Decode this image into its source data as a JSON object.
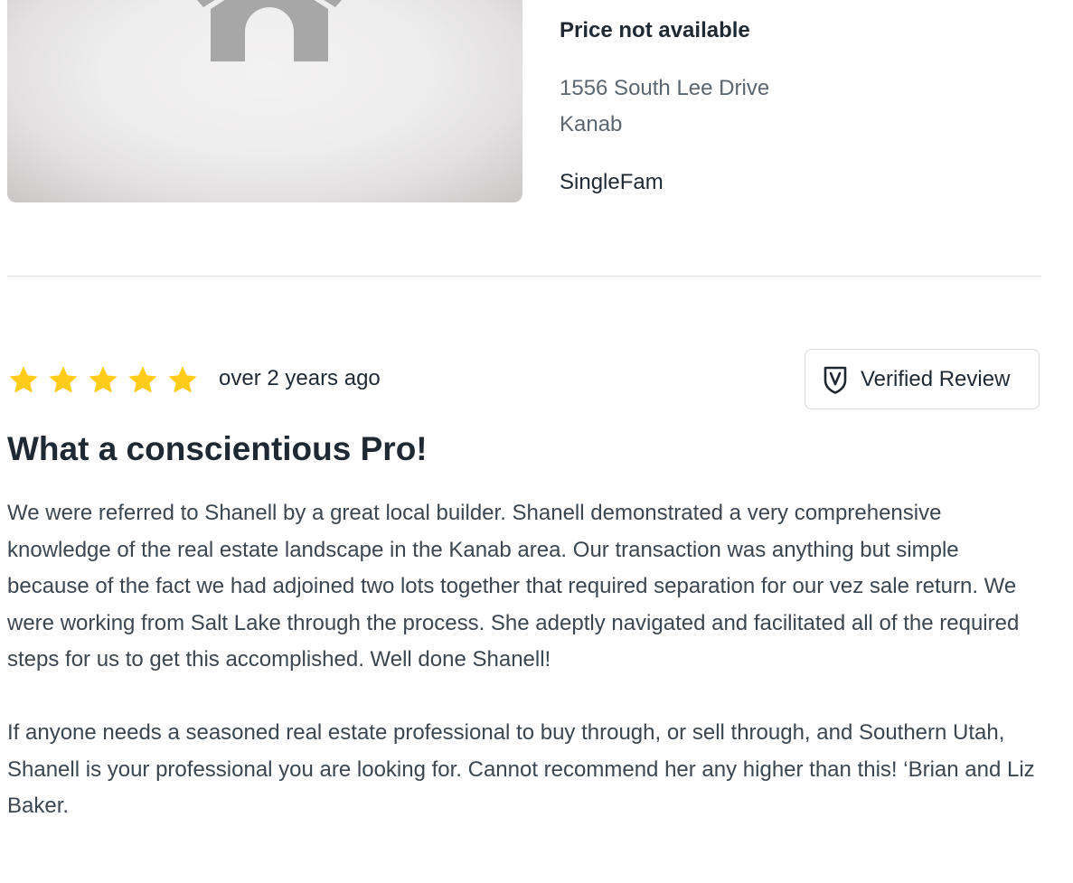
{
  "listing": {
    "price": "Price not available",
    "address_line1": "1556 South Lee Drive",
    "address_line2": "Kanab",
    "property_type": "SingleFam",
    "image_icon": "house-placeholder-icon"
  },
  "review": {
    "rating": 5,
    "rating_max": 5,
    "date": "over 2 years ago",
    "verified_label": "Verified Review",
    "verified_icon": "shield-check-icon",
    "title": "What a conscientious Pro!",
    "paragraphs": [
      "We were referred to Shanell by a great local builder.  Shanell demonstrated a very comprehensive knowledge of the real estate landscape in the Kanab area. Our transaction was anything but simple because of the fact we had adjoined two lots together that required separation for our vez sale return. We were working from Salt Lake through the process. She adeptly navigated and facilitated all of the required steps for us to get this accomplished. Well done Shanell!",
      "If anyone needs a seasoned real estate professional to buy through, or sell through, and Southern Utah, Shanell is your professional you are looking for. Cannot recommend her any higher than this! ‘Brian and Liz Baker."
    ]
  },
  "colors": {
    "star": "#FFCC1C",
    "text_primary": "#1f2933",
    "text_secondary": "#5b6670",
    "divider": "#dde1e5",
    "badge_border": "#d6dbe0"
  }
}
